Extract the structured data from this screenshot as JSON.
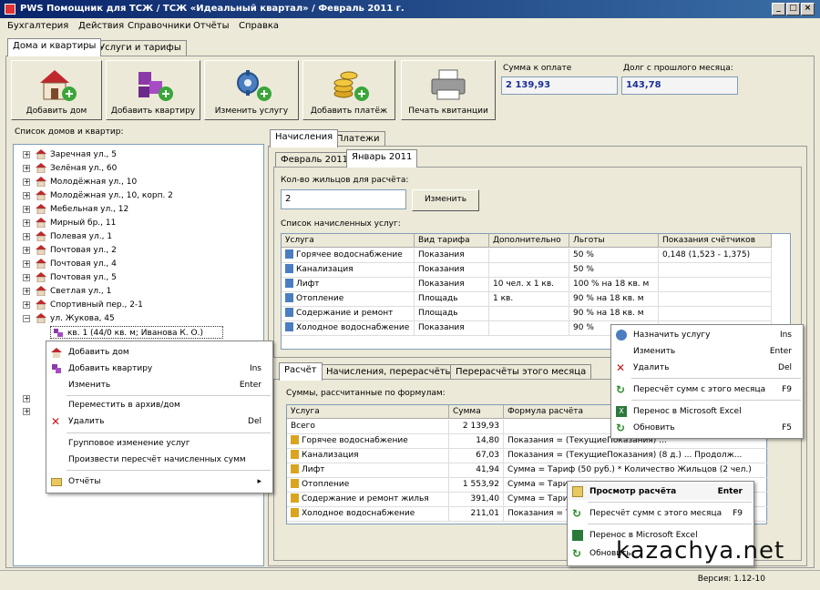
{
  "window": {
    "title": "PWS Помощник для ТСЖ / ТСЖ «Идеальный квартал» / Февраль 2011 г."
  },
  "menu": [
    "Бухгалтерия",
    "Действия",
    "Справочники",
    "Отчёты",
    "Справка"
  ],
  "main_tabs": [
    "Дома и квартиры",
    "Услуги и тарифы"
  ],
  "toolbar": [
    {
      "label": "Добавить дом",
      "icon": "add-house-icon"
    },
    {
      "label": "Добавить квартиру",
      "icon": "add-apartment-icon"
    },
    {
      "label": "Изменить услугу",
      "icon": "edit-service-icon"
    },
    {
      "label": "Добавить платёж",
      "icon": "add-payment-icon"
    },
    {
      "label": "Печать квитанции",
      "icon": "printer-icon"
    }
  ],
  "summary": {
    "sum_label": "Сумма к оплате",
    "sum_value": "2 139,93",
    "debt_label": "Долг с прошлого месяца:",
    "debt_value": "143,78"
  },
  "tree": {
    "label": "Список домов и квартир:",
    "items": [
      "Заречная ул., 5",
      "Зелёная ул., 60",
      "Молодёжная ул., 10",
      "Молодёжная ул., 10, корп. 2",
      "Мебельная ул., 12",
      "Мирный бр., 11",
      "Полевая ул., 1",
      "Почтовая ул., 2",
      "Почтовая ул., 4",
      "Почтовая ул., 5",
      "Светлая ул., 1",
      "Спортивный пер., 2-1"
    ],
    "expanded": "ул. Жукова, 45",
    "selected": "кв. 1 (44/0 кв. м; Иванова К. О.)"
  },
  "right_tabs": [
    "Начисления",
    "Платежи"
  ],
  "month_tabs": [
    "Февраль 2011",
    "Январь 2011"
  ],
  "residents": {
    "label": "Кол-во жильцов для расчёта:",
    "value": "2",
    "button": "Изменить"
  },
  "services": {
    "label": "Список начисленных услуг:",
    "columns": [
      "Услуга",
      "Вид тарифа",
      "Дополнительно",
      "Льготы",
      "Показания счётчиков"
    ],
    "rows": [
      [
        "Горячее водоснабжение",
        "Показания",
        "",
        "50 %",
        "0,148 (1,523 - 1,375)"
      ],
      [
        "Канализация",
        "Показания",
        "",
        "50 %",
        ""
      ],
      [
        "Лифт",
        "Показания",
        "10 чел. х 1 кв.",
        "100 % на 18 кв. м",
        ""
      ],
      [
        "Отопление",
        "Площадь",
        "1 кв.",
        "90 % на 18 кв. м",
        ""
      ],
      [
        "Содержание и ремонт",
        "Площадь",
        "",
        "90 % на 18 кв. м",
        ""
      ],
      [
        "Холодное водоснабжение",
        "Показания",
        "",
        "90 %",
        ""
      ]
    ]
  },
  "bottom_tabs": [
    "Расчёт",
    "Начисления, перерасчёты",
    "Перерасчёты этого месяца"
  ],
  "calc": {
    "label": "Суммы, рассчитанные по формулам:",
    "columns": [
      "Услуга",
      "Сумма",
      "Формула расчёта"
    ],
    "rows": [
      [
        "Всего",
        "2 139,93",
        ""
      ],
      [
        "Горячее водоснабжение",
        "14,80",
        "Показания = (ТекущиеПоказания) ..."
      ],
      [
        "Канализация",
        "67,03",
        "Показания = (ТекущиеПоказания) (8 д.) ... Продолж..."
      ],
      [
        "Лифт",
        "41,94",
        "Сумма = Тариф (50 руб.) * Количество Жильцов (2 чел.)"
      ],
      [
        "Отопление",
        "1 553,92",
        "Сумма = Тариф"
      ],
      [
        "Содержание и ремонт жилья",
        "391,40",
        "Сумма = Тариф"
      ],
      [
        "Холодное водоснабжение",
        "211,01",
        "Показания = Т"
      ]
    ]
  },
  "context_menu_tree": [
    {
      "label": "Добавить дом",
      "shortcut": "",
      "icon": "house-icon"
    },
    {
      "label": "Добавить квартиру",
      "shortcut": "Ins",
      "icon": "apartment-icon"
    },
    {
      "label": "Изменить",
      "shortcut": "Enter",
      "icon": ""
    },
    {
      "label": "Переместить в архив/дом",
      "shortcut": "",
      "icon": ""
    },
    {
      "label": "Удалить",
      "shortcut": "Del",
      "icon": "delete-icon"
    },
    {
      "label": "Групповое изменение услуг",
      "shortcut": "",
      "icon": ""
    },
    {
      "label": "Произвести пересчёт начисленных сумм",
      "shortcut": "",
      "icon": ""
    },
    {
      "label": "Отчёты",
      "shortcut": "▸",
      "icon": "folder-icon"
    }
  ],
  "context_menu_services": [
    {
      "label": "Назначить услугу",
      "shortcut": "Ins",
      "icon": "service-icon"
    },
    {
      "label": "Изменить",
      "shortcut": "Enter",
      "icon": ""
    },
    {
      "label": "Удалить",
      "shortcut": "Del",
      "icon": "delete-icon"
    },
    {
      "label": "Пересчёт сумм с этого месяца",
      "shortcut": "F9",
      "icon": "recalc-icon"
    },
    {
      "label": "Перенос в Microsoft Excel",
      "shortcut": "",
      "icon": "excel-icon"
    },
    {
      "label": "Обновить",
      "shortcut": "F5",
      "icon": "refresh-icon"
    }
  ],
  "context_menu_calc": [
    {
      "label": "Просмотр расчёта",
      "shortcut": "Enter",
      "icon": "view-icon"
    },
    {
      "label": "Пересчёт сумм с этого месяца",
      "shortcut": "F9",
      "icon": "recalc-icon"
    },
    {
      "label": "Перенос в Microsoft Excel",
      "shortcut": "",
      "icon": "excel-icon"
    },
    {
      "label": "Обновить",
      "shortcut": "",
      "icon": "refresh-icon"
    }
  ],
  "status": {
    "version": "Версия: 1.12-10"
  },
  "watermark": "kazachya.net",
  "colors": {
    "titlebar": "#0a246a",
    "accent_blue": "#1a2f9a",
    "delete_red": "#cc1111",
    "recalc_green": "#2a8a2a"
  }
}
